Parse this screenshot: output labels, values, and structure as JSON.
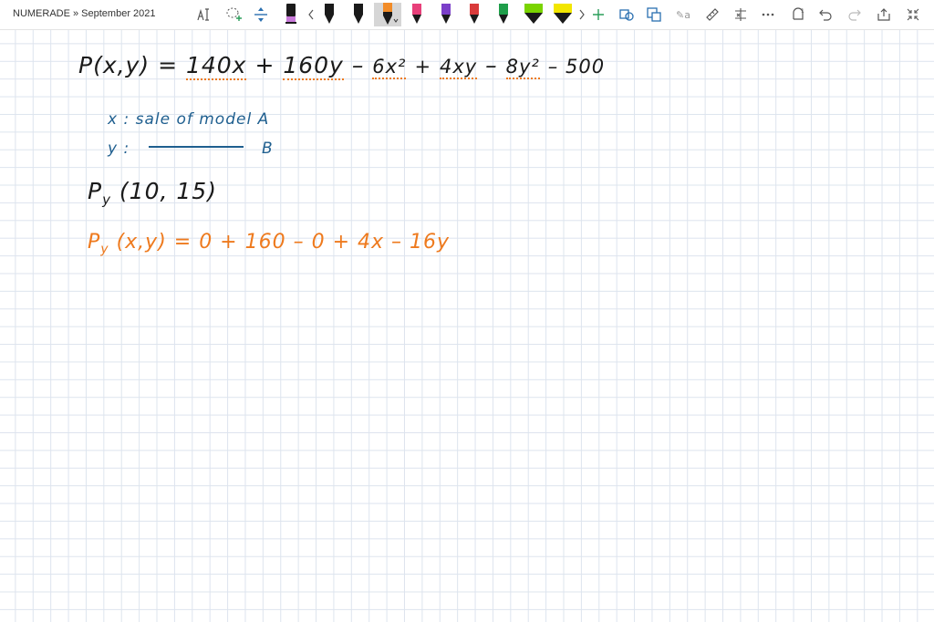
{
  "app": {
    "breadcrumb": "NUMERADE » September 2021"
  },
  "toolbar": {
    "icons": [
      "text-select-icon",
      "lasso-add-icon",
      "add-space-icon",
      "pen-black-icon",
      "scroll-left-icon",
      "pen-black-icon",
      "pen-black-icon",
      "pen-orange-icon",
      "pen-pink-icon",
      "pen-purple-icon",
      "pen-red-icon",
      "pen-green-icon",
      "highlighter-green-icon",
      "highlighter-yellow-icon",
      "scroll-right-icon",
      "add-pen-icon",
      "ink-to-shape-icon",
      "ink-to-text-icon",
      "ink-to-math-icon",
      "ruler-icon",
      "math-icon",
      "more-icon",
      "replay-icon",
      "undo-icon",
      "redo-icon",
      "fullscreen-share-icon",
      "collapse-icon"
    ],
    "colors": {
      "purple_pen": "#c879d9",
      "orange_pen": "#f28c28",
      "pink_pen": "#e8407a",
      "violet_pen": "#7b3fc9",
      "red_pen": "#d93a3a",
      "green_pen": "#1f9e4a",
      "green_highlighter": "#7ad400",
      "yellow_highlighter": "#f2e600"
    }
  },
  "notes": {
    "line1": {
      "lhs": "P(x,y) =",
      "t1": "140x",
      "op1": "+",
      "t2": "160y",
      "op2": "–",
      "t3": "6x²",
      "op3": "+",
      "t4": "4xy",
      "op4": "–",
      "t5": "8y²",
      "op5": "– 500"
    },
    "def_x": "x : sale of model A",
    "def_y_label": "y :",
    "def_y_end": "B",
    "partial_label": "P",
    "partial_sub": "y",
    "partial_args": "(10, 15)",
    "deriv_label": "P",
    "deriv_sub": "y",
    "deriv_rest": "(x,y) = 0 + 160 – 0 + 4x – 16y"
  },
  "ink_colors": {
    "black": "#1a1a1a",
    "blue": "#1f5f8f",
    "orange": "#ee7a1e"
  }
}
